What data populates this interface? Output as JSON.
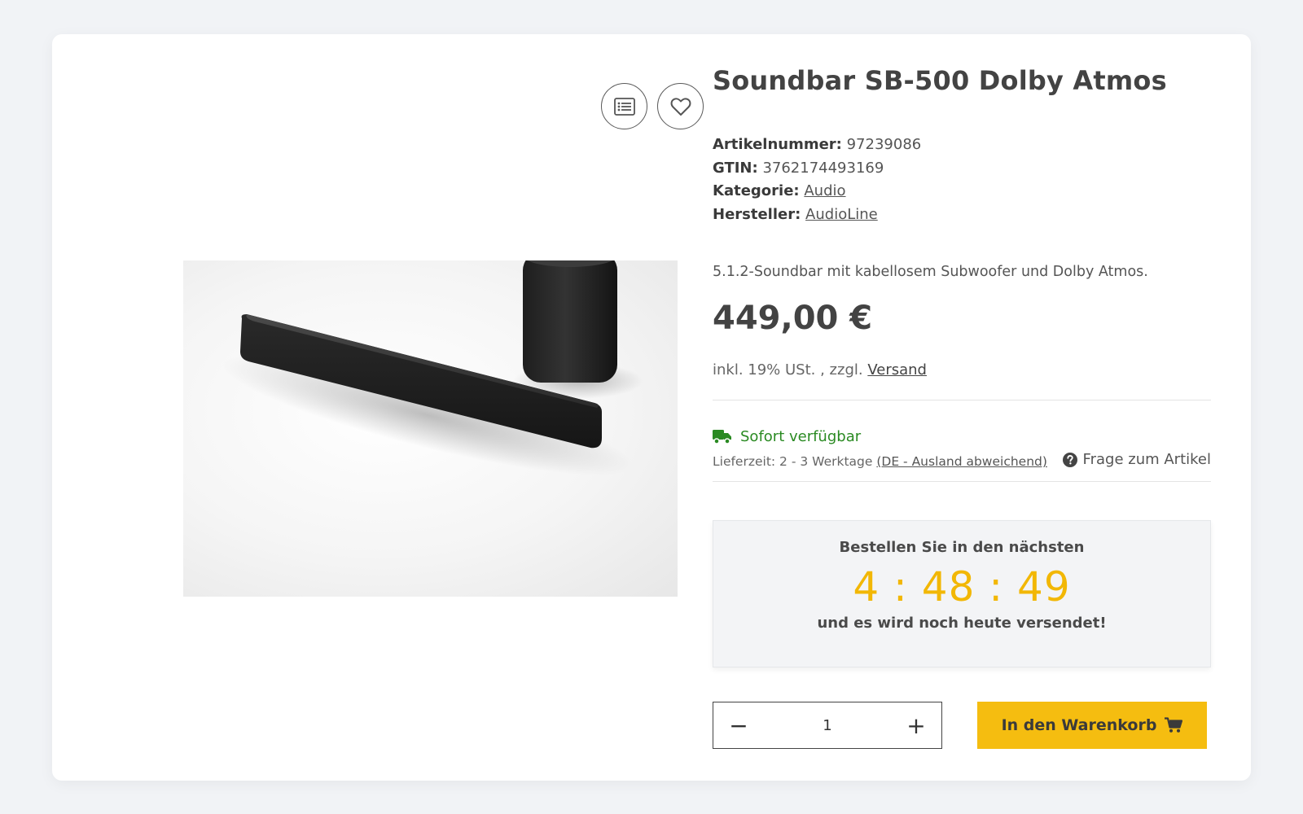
{
  "product": {
    "title": "Soundbar SB-500 Dolby Atmos",
    "image_alt": "Soundbar mit Subwoofer",
    "article_number_label": "Artikelnummer:",
    "article_number": "97239086",
    "gtin_label": "GTIN:",
    "gtin": "3762174493169",
    "category_label": "Kategorie:",
    "category": "Audio",
    "manufacturer_label": "Hersteller:",
    "manufacturer": "AudioLine",
    "description": "5.1.2-Soundbar mit kabellosem Subwoofer und Dolby Atmos.",
    "price": "449,00 €",
    "tax_text": "inkl. 19% USt. , zzgl.",
    "shipping_link": "Versand"
  },
  "availability": {
    "status": "Sofort verfügbar",
    "status_color": "#2a8a22",
    "delivery_text": "Lieferzeit: 2 - 3 Werktage",
    "delivery_link": "(DE - Ausland abweichend)",
    "question_link": "Frage zum Artikel"
  },
  "countdown": {
    "top_text": "Bestellen Sie in den nächsten",
    "timer": "4 : 48 : 49",
    "bottom_text": "und es wird noch heute versendet!",
    "timer_color": "#f2b705"
  },
  "purchase": {
    "quantity": "1",
    "minus": "−",
    "plus": "+",
    "cart_label": "In den Warenkorb",
    "cart_color": "#f5bd10"
  },
  "icons": {
    "compare": "list-icon",
    "wishlist": "heart-icon",
    "truck": "truck-icon",
    "question": "question-circle-icon",
    "cart": "cart-icon"
  }
}
